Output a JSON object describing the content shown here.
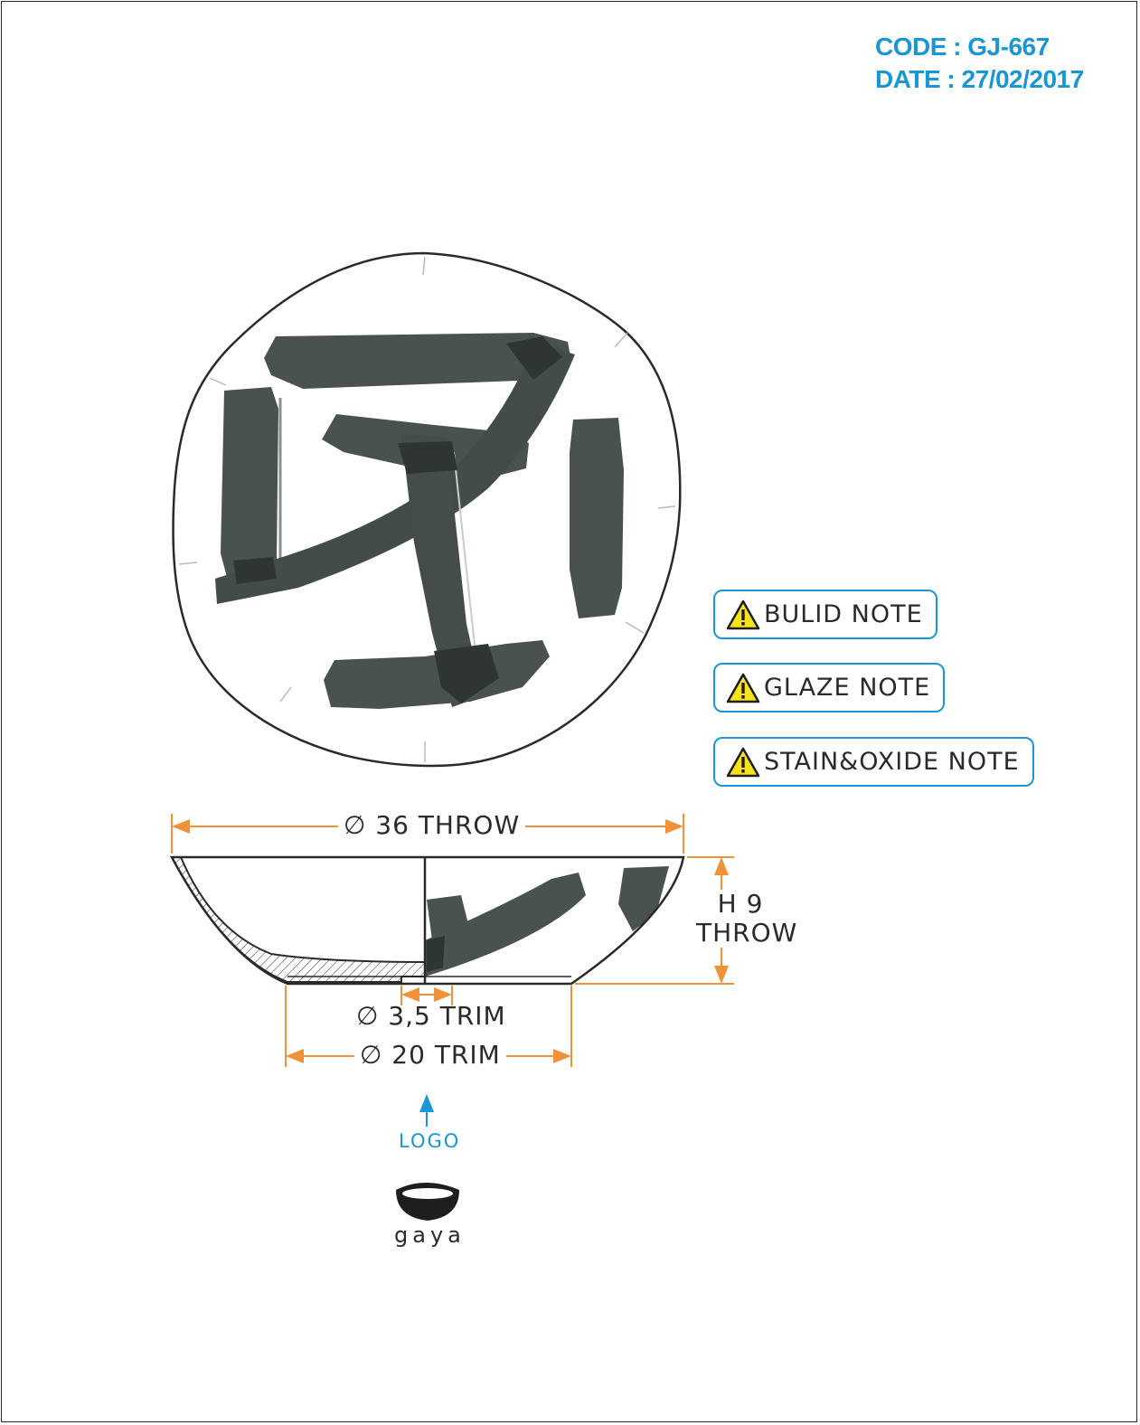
{
  "header": {
    "code": "CODE : GJ-667",
    "date": "DATE : 27/02/2017"
  },
  "notes": [
    {
      "label": "BULID NOTE",
      "icon": "warning-icon"
    },
    {
      "label": "GLAZE NOTE",
      "icon": "warning-icon"
    },
    {
      "label": "STAIN&OXIDE NOTE",
      "icon": "warning-icon"
    }
  ],
  "dimensions": {
    "diameter_throw": "∅ 36 THROW",
    "height_line1": "H 9",
    "height_line2": "THROW",
    "foot_hole_trim": "∅ 3,5 TRIM",
    "foot_trim": "∅ 20 TRIM"
  },
  "logo": {
    "label": "LOGO",
    "brand": "gaya"
  },
  "colors": {
    "accent_blue": "#1b96d4",
    "dimension_orange": "#f0923a",
    "glaze_dark": "#4a524f",
    "outline": "#2a2a2a",
    "warning_yellow": "#f7e21b"
  }
}
